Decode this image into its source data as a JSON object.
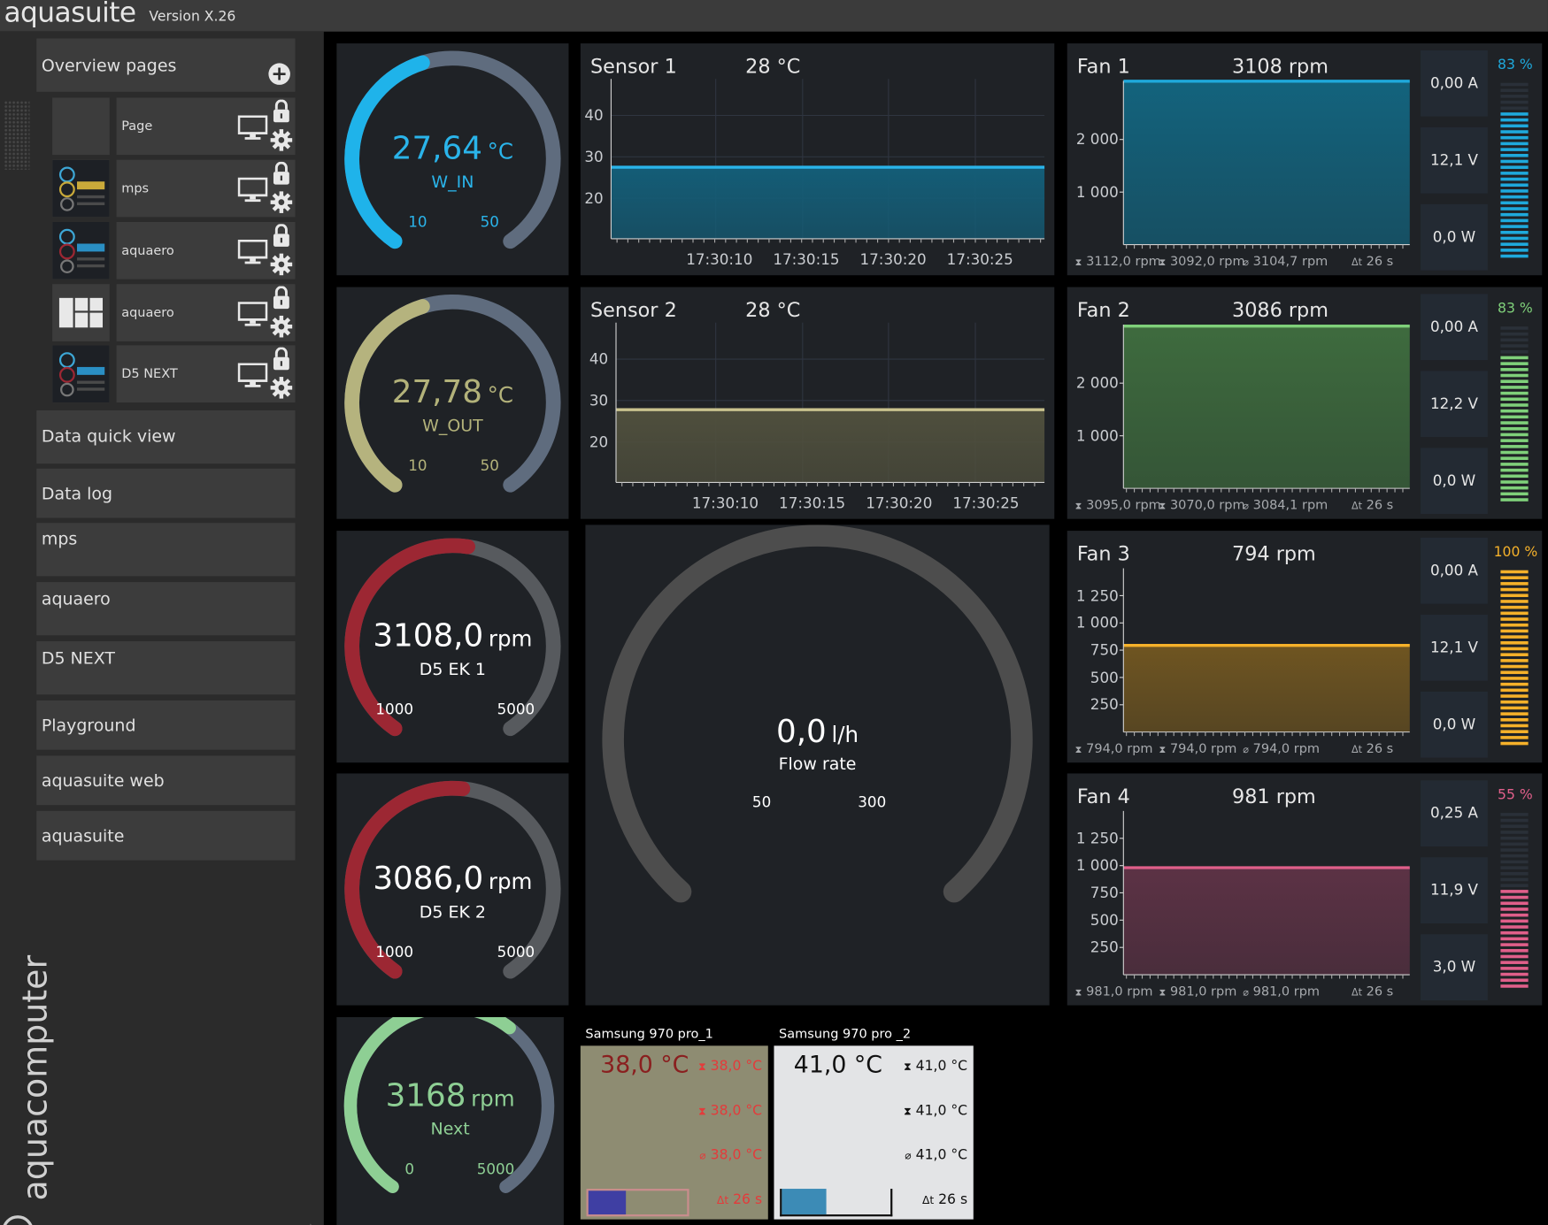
{
  "app": {
    "brand": "aquasuite",
    "version": "Version X.26",
    "vertical_brand": "aquacomputer"
  },
  "sidebar": {
    "overview_label": "Overview pages",
    "pages": [
      {
        "label": "Page"
      },
      {
        "label": "mps"
      },
      {
        "label": "aquaero"
      },
      {
        "label": "aquaero"
      },
      {
        "label": "D5 NEXT"
      }
    ],
    "items": [
      {
        "label": "Data quick view"
      },
      {
        "label": "Data log"
      },
      {
        "label": "mps"
      },
      {
        "label": "aquaero"
      },
      {
        "label": "D5 NEXT"
      },
      {
        "label": "Playground"
      },
      {
        "label": "aquasuite web"
      },
      {
        "label": "aquasuite"
      }
    ]
  },
  "gauges": [
    {
      "value": "27,64",
      "unit": "°C",
      "name": "W_IN",
      "min": "10",
      "max": "50",
      "fraction": 0.44,
      "color": "#1fb3ea",
      "text_color": "#2ab4ea",
      "track": "#5f6c7e"
    },
    {
      "value": "27,78",
      "unit": "°C",
      "name": "W_OUT",
      "min": "10",
      "max": "50",
      "fraction": 0.44,
      "color": "#b5b37e",
      "text_color": "#b3b27a",
      "track": "#5f6c7e"
    },
    {
      "value": "3108,0",
      "unit": "rpm",
      "name": "D5 EK 1",
      "min": "1000",
      "max": "5000",
      "fraction": 0.53,
      "color": "#9c2733",
      "text_color": "#ffffff",
      "track": "#575a5e"
    },
    {
      "value": "3086,0",
      "unit": "rpm",
      "name": "D5 EK 2",
      "min": "1000",
      "max": "5000",
      "fraction": 0.52,
      "color": "#9c2733",
      "text_color": "#ffffff",
      "track": "#575a5e"
    },
    {
      "value": "3168",
      "unit": "rpm",
      "name": "Next",
      "min": "0",
      "max": "5000",
      "fraction": 0.63,
      "color": "#8ecf94",
      "text_color": "#8ecf94",
      "track": "#5f6c7e"
    }
  ],
  "flow": {
    "value": "0,0",
    "unit": "l/h",
    "name": "Flow rate",
    "min": "50",
    "max": "300",
    "fraction": 0.0
  },
  "sensors": [
    {
      "title": "Sensor 1",
      "value": "28 °C",
      "color": "#2ab4ea",
      "fill": "#145d77",
      "y_ticks": [
        "40",
        "30",
        "20"
      ],
      "x_ticks": [
        "17:30:10",
        "17:30:15",
        "17:30:20",
        "17:30:25"
      ]
    },
    {
      "title": "Sensor 2",
      "value": "28 °C",
      "color": "#c9c38e",
      "fill": "#4f4f3d",
      "y_ticks": [
        "40",
        "30",
        "20"
      ],
      "x_ticks": [
        "17:30:10",
        "17:30:15",
        "17:30:20",
        "17:30:25"
      ]
    }
  ],
  "fans": [
    {
      "title": "Fan 1",
      "rpm": "3108 rpm",
      "amps": "0,00 A",
      "volts": "12,1 V",
      "watts": "0,0 W",
      "pct": "83 %",
      "pct_value": 83,
      "color": "#1fa9dc",
      "fill": "#13637d",
      "pct_color": "#1fa9dc",
      "y_ticks": [
        "2 000",
        "1 000"
      ],
      "stats": {
        "max": "3112,0 rpm",
        "min": "3092,0 rpm",
        "avg": "3104,7 rpm",
        "time": "26 s"
      }
    },
    {
      "title": "Fan 2",
      "rpm": "3086 rpm",
      "amps": "0,00 A",
      "volts": "12,2 V",
      "watts": "0,0 W",
      "pct": "83 %",
      "pct_value": 83,
      "color": "#7fd07a",
      "fill": "#3e6b3e",
      "pct_color": "#7fd07a",
      "y_ticks": [
        "2 000",
        "1 000"
      ],
      "stats": {
        "max": "3095,0 rpm",
        "min": "3070,0 rpm",
        "avg": "3084,1 rpm",
        "time": "26 s"
      }
    },
    {
      "title": "Fan 3",
      "rpm": "794 rpm",
      "amps": "0,00 A",
      "volts": "12,1 V",
      "watts": "0,0 W",
      "pct": "100 %",
      "pct_value": 100,
      "color": "#f5b12a",
      "fill": "#6f5521",
      "pct_color": "#f5b12a",
      "y_ticks": [
        "1 250",
        "1 000",
        "750",
        "500",
        "250"
      ],
      "stats": {
        "max": "794,0 rpm",
        "min": "794,0 rpm",
        "avg": "794,0 rpm",
        "time": "26 s"
      }
    },
    {
      "title": "Fan 4",
      "rpm": "981 rpm",
      "amps": "0,25 A",
      "volts": "11,9 V",
      "watts": "3,0 W",
      "pct": "55 %",
      "pct_value": 55,
      "color": "#e05f8a",
      "fill": "#5c3245",
      "pct_color": "#e05f8a",
      "y_ticks": [
        "1 250",
        "1 000",
        "750",
        "500",
        "250"
      ],
      "stats": {
        "max": "981,0 rpm",
        "min": "981,0 rpm",
        "avg": "981,0 rpm",
        "time": "26 s"
      }
    }
  ],
  "ssds": [
    {
      "title": "Samsung 970 pro_1",
      "temp": "38,0 °C",
      "max": "38,0 °C",
      "min": "38,0 °C",
      "avg": "38,0 °C",
      "time": "26 s",
      "bg": "#8e8c72",
      "fg": "#8a1f1f",
      "accent": "#e33b3b",
      "bar": "#3f3fa3",
      "bar_border": "#c98d8d",
      "level": 0.38
    },
    {
      "title": "Samsung 970 pro _2",
      "temp": "41,0 °C",
      "max": "41,0 °C",
      "min": "41,0 °C",
      "avg": "41,0 °C",
      "time": "26 s",
      "bg": "#e3e4e6",
      "fg": "#111111",
      "accent": "#111111",
      "bar": "#3c8bb6",
      "bar_border": "#111111",
      "level": 0.41
    }
  ]
}
